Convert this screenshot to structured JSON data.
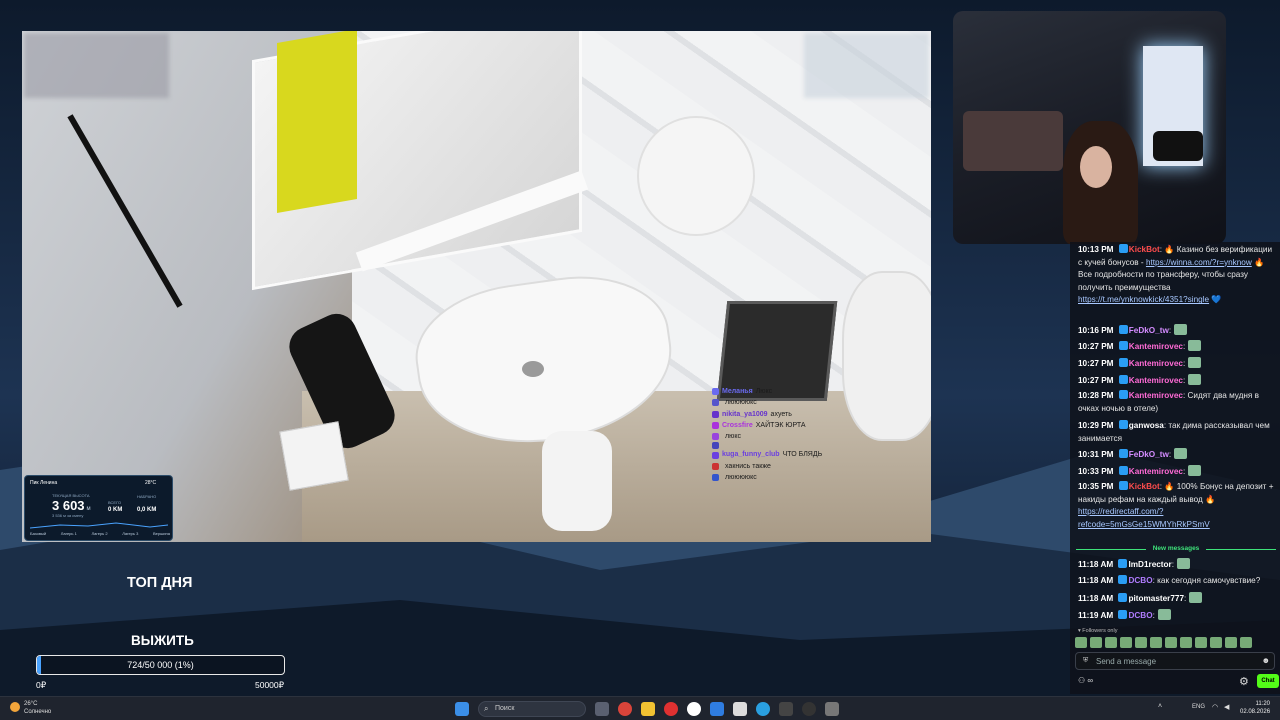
{
  "stream_overlay_chat": [
    {
      "user": "Меланья",
      "text": "Люкс",
      "color": "#6a6af0"
    },
    {
      "user": "",
      "text": "лююююкс",
      "color": "#5555cc"
    },
    {
      "user": "nikita_ya1009",
      "text": "ахуеть",
      "color": "#6633cc"
    },
    {
      "user": "Crossfire",
      "text": "ХАЙТЭК ЮРТА",
      "color": "#aa33dd"
    },
    {
      "user": "",
      "text": "люкс",
      "color": "#9944dd"
    },
    {
      "user": "",
      "text": "",
      "color": "#4444bb"
    },
    {
      "user": "kuga_funny_club",
      "text": "ЧТО БЛЯДЬ",
      "color": "#6b3fe0"
    },
    {
      "user": "",
      "text": "хакнись также",
      "color": "#cc3333"
    },
    {
      "user": "",
      "text": "лююююкс",
      "color": "#3355cc"
    }
  ],
  "stats_widget": {
    "location": "Пик Ленина",
    "temperature": "28°C",
    "altitude_label": "ТЕКУЩАЯ ВЫСОТА",
    "altitude": "3 603",
    "altitude_unit": "м",
    "sub": "3 536 м за смену",
    "km1_label": "ВСЕГО",
    "km1": "0 KM",
    "km2_label": "НАБРАНО",
    "km2": "0 KM",
    "km3_label": "ПРОЙДЕНО",
    "km3": "0,0 KM",
    "points": [
      "Базовый",
      "Лагерь 1",
      "Лагерь 2",
      "Лагерь 3",
      "Вершина"
    ]
  },
  "chat": {
    "messages": [
      {
        "time": "10:13 PM",
        "user": "KickBot",
        "user_color": "#ff4d4d",
        "text": ": 🔥 Казино без верификации с кучей бонусов - ",
        "link": "https://winna.com/?r=ynknow",
        "text2": " 🔥 Все подробности по трансферу, чтобы сразу получить преимущества ",
        "link2": "https://t.me/ynknowkick/4351?single",
        "text3": " 💙"
      },
      {
        "time": "10:16 PM",
        "user": "FeDkO_tw",
        "user_color": "#d48cff",
        "text": ":"
      },
      {
        "time": "10:27 PM",
        "user": "Kantemirovec",
        "user_color": "#ff6bd6",
        "text": ":"
      },
      {
        "time": "10:27 PM",
        "user": "Kantemirovec",
        "user_color": "#ff6bd6",
        "text": ":"
      },
      {
        "time": "10:27 PM",
        "user": "Kantemirovec",
        "user_color": "#ff6bd6",
        "text": ":"
      },
      {
        "time": "10:28 PM",
        "user": "Kantemirovec",
        "user_color": "#ff6bd6",
        "text": ": Сидят два мудня в очках ночью в отеле)"
      },
      {
        "time": "10:29 PM",
        "user": "ganwosa",
        "user_color": "#ffffff",
        "text": ": так дима рассказывал чем занимается"
      },
      {
        "time": "10:31 PM",
        "user": "FeDkO_tw",
        "user_color": "#d48cff",
        "text": ":"
      },
      {
        "time": "10:33 PM",
        "user": "Kantemirovec",
        "user_color": "#ff6bd6",
        "text": ":"
      },
      {
        "time": "10:35 PM",
        "user": "KickBot",
        "user_color": "#ff4d4d",
        "text": ": 🔥 100% Бонус на депозит + накиды рефам на каждый вывод 🔥 ",
        "link": "https://redirectaff.com/?refcode=5mGsGe15WMYhRkPSmV"
      }
    ],
    "new_messages_label": "New messages",
    "new": [
      {
        "time": "11:18 AM",
        "user": "ImD1rector",
        "user_color": "#ffffff",
        "text": ":"
      },
      {
        "time": "11:18 AM",
        "user": "DCBO",
        "user_color": "#b07cff",
        "text": ": как сегодня самочувствие?"
      },
      {
        "time": "11:18 AM",
        "user": "pitomaster777",
        "user_color": "#ffffff",
        "text": ":"
      },
      {
        "time": "11:19 AM",
        "user": "DCBO",
        "user_color": "#b07cff",
        "text": ":"
      }
    ],
    "followers_only": "Followers only",
    "send_placeholder": "Send a message",
    "footer_icon_text": "∞",
    "chat_button": "Chat"
  },
  "goals": {
    "top_day": "ТОП ДНЯ",
    "survive": "ВЫЖИТЬ",
    "progress_text": "724/50 000 (1%)",
    "progress_fraction": 0.0145,
    "min": "0₽",
    "max": "50000₽"
  },
  "taskbar": {
    "weather_temp": "26°C",
    "weather_desc": "Солнечно",
    "search_placeholder": "Поиск",
    "lang": "ENG",
    "time": "11:20",
    "date": "02.08.2026"
  }
}
